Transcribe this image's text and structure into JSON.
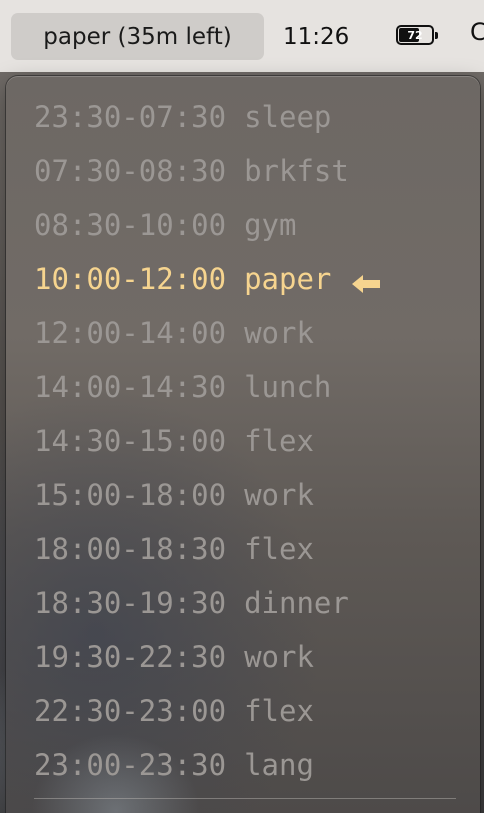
{
  "menubar": {
    "active_item": "paper (35m left)",
    "clock": "11:26",
    "battery": {
      "percent_text": "72",
      "level": 0.72
    },
    "clipped_item": "C"
  },
  "schedule": {
    "current_index": 3,
    "items": [
      {
        "time": "23:30-07:30",
        "label": "sleep"
      },
      {
        "time": "07:30-08:30",
        "label": "brkfst"
      },
      {
        "time": "08:30-10:00",
        "label": "gym"
      },
      {
        "time": "10:00-12:00",
        "label": "paper"
      },
      {
        "time": "12:00-14:00",
        "label": "work"
      },
      {
        "time": "14:00-14:30",
        "label": "lunch"
      },
      {
        "time": "14:30-15:00",
        "label": "flex"
      },
      {
        "time": "15:00-18:00",
        "label": "work"
      },
      {
        "time": "18:00-18:30",
        "label": "flex"
      },
      {
        "time": "18:30-19:30",
        "label": "dinner"
      },
      {
        "time": "19:30-22:30",
        "label": "work"
      },
      {
        "time": "22:30-23:00",
        "label": "flex"
      },
      {
        "time": "23:00-23:30",
        "label": "lang"
      }
    ]
  },
  "colors": {
    "current_item": "#f6d48f",
    "inactive_item": "#9b9794"
  },
  "icons": {
    "current_marker": "left-arrow-icon"
  }
}
